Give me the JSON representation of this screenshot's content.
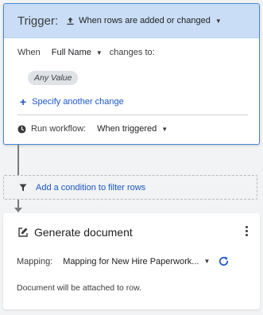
{
  "trigger": {
    "title": "Trigger:",
    "event": "When rows are added or changed",
    "when_label": "When",
    "column": "Full Name",
    "changes_to": "changes to:",
    "value_chip": "Any Value",
    "specify_link": "Specify another change",
    "run_label": "Run workflow:",
    "run_value": "When triggered"
  },
  "condition": {
    "label": "Add a condition to filter rows"
  },
  "action": {
    "title": "Generate document",
    "mapping_label": "Mapping:",
    "mapping_value": "Mapping for New Hire Paperwork...",
    "note": "Document will be attached to row."
  },
  "colors": {
    "accent": "#1a56c4",
    "header_bg": "#c9def6",
    "border_active": "#4a86d8"
  },
  "icons": [
    "upload-icon",
    "clock-icon",
    "filter-icon",
    "edit-document-icon",
    "more-vert-icon",
    "refresh-icon"
  ]
}
